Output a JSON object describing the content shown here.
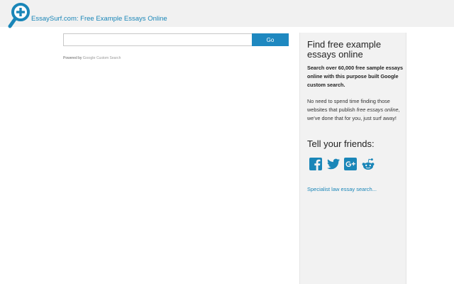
{
  "header": {
    "logo_icon": "magnifier-plus-icon",
    "site_title": "EssaySurf.com: Free Example Essays Online"
  },
  "search": {
    "value": "",
    "placeholder": "",
    "go_label": "Go",
    "powered_by": "Powered by",
    "google": "Google",
    "custom_search": "Custom Search"
  },
  "sidebar": {
    "title": "Find free example essays online",
    "bold_text": "Search over 60,000 free sample essays online with this purpose built Google custom search.",
    "para_before": "No need to spend time finding those websites that publish ",
    "para_italic": "free essays online",
    "para_after": ", we've done that for you, just surf away!",
    "tell_title": "Tell your friends:",
    "social": [
      {
        "name": "facebook-icon"
      },
      {
        "name": "twitter-icon"
      },
      {
        "name": "google-plus-icon"
      },
      {
        "name": "reddit-icon"
      }
    ],
    "law_link": "Specialist law essay search..."
  },
  "colors": {
    "accent": "#1a86b8",
    "go_button": "#1e88c0",
    "header_bg": "#f1f1f1",
    "sidebar_bg": "#f2f2f2",
    "social_icon": "#1a86b8"
  }
}
